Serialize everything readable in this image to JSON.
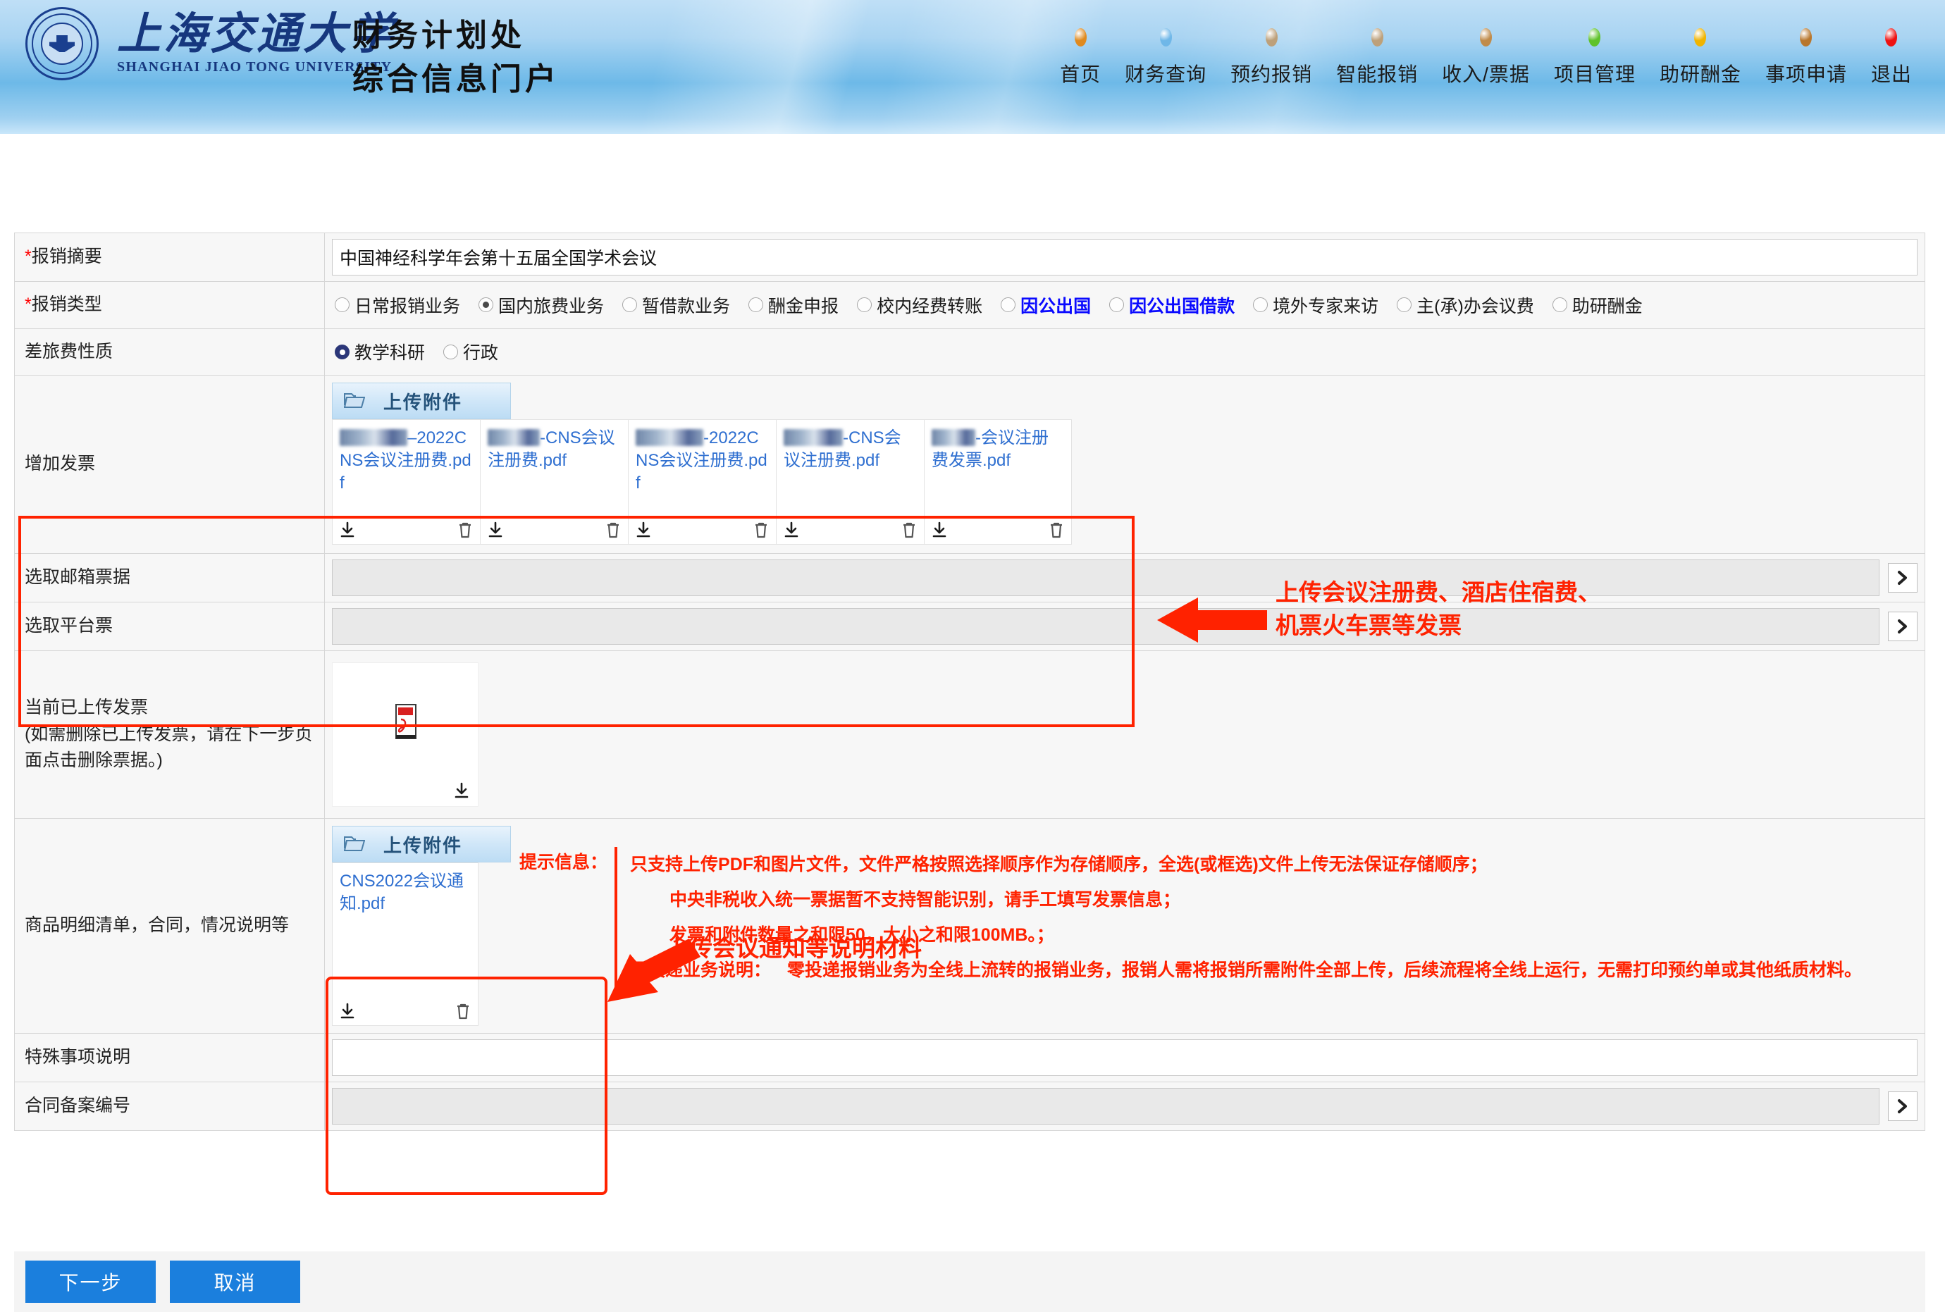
{
  "header": {
    "university_cn": "上海交通大学",
    "university_en": "SHANGHAI JIAO TONG UNIVERSITY",
    "dept_line1": "财务计划处",
    "dept_line2": "综合信息门户",
    "nav": [
      {
        "label": "首页",
        "dot": "#e08a1e"
      },
      {
        "label": "财务查询",
        "dot": "#6fb7e8"
      },
      {
        "label": "预约报销",
        "dot": "#bda07a"
      },
      {
        "label": "智能报销",
        "dot": "#bda07a"
      },
      {
        "label": "收入/票据",
        "dot": "#c08b4a"
      },
      {
        "label": "项目管理",
        "dot": "#5fc22a"
      },
      {
        "label": "助研酬金",
        "dot": "#f0b400"
      },
      {
        "label": "事项申请",
        "dot": "#b8762c"
      },
      {
        "label": "退出",
        "dot": "#ee1111"
      }
    ]
  },
  "form": {
    "summary": {
      "label": "报销摘要",
      "required": true,
      "value": "中国神经科学年会第十五届全国学术会议",
      "placeholder": ""
    },
    "reimb_type": {
      "label": "报销类型",
      "required": true,
      "options": [
        {
          "label": "日常报销业务",
          "selected": false,
          "blue": false
        },
        {
          "label": "国内旅费业务",
          "selected": true,
          "blue": false
        },
        {
          "label": "暂借款业务",
          "selected": false,
          "blue": false
        },
        {
          "label": "酬金申报",
          "selected": false,
          "blue": false
        },
        {
          "label": "校内经费转账",
          "selected": false,
          "blue": false
        },
        {
          "label": "因公出国",
          "selected": false,
          "blue": true
        },
        {
          "label": "因公出国借款",
          "selected": false,
          "blue": true
        },
        {
          "label": "境外专家来访",
          "selected": false,
          "blue": false
        },
        {
          "label": "主(承)办会议费",
          "selected": false,
          "blue": false
        },
        {
          "label": "助研酬金",
          "selected": false,
          "blue": false
        }
      ]
    },
    "travel_nature": {
      "label": "差旅费性质",
      "options": [
        {
          "label": "教学科研",
          "selected": true
        },
        {
          "label": "行政",
          "selected": false
        }
      ]
    },
    "add_invoice": {
      "label": "增加发票",
      "upload_button": "上传附件",
      "files": [
        {
          "redacted": true,
          "redact_width": 96,
          "name": "–2022CNS会议注册费.pdf"
        },
        {
          "redacted": true,
          "redact_width": 74,
          "name": "-CNS会议注册费.pdf"
        },
        {
          "redacted": true,
          "redact_width": 96,
          "name": "-2022CNS会议注册费.pdf"
        },
        {
          "redacted": true,
          "redact_width": 84,
          "name": "-CNS会议注册费.pdf"
        },
        {
          "redacted": true,
          "redact_width": 62,
          "name": "-会议注册费发票.pdf"
        }
      ]
    },
    "mail_invoice": {
      "label": "选取邮箱票据",
      "value": "",
      "placeholder": ""
    },
    "platform_invoice": {
      "label": "选取平台票",
      "value": "",
      "placeholder": ""
    },
    "uploaded_invoice": {
      "label_line1": "当前已上传发票",
      "label_line2": "(如需删除已上传发票，请在下一步页",
      "label_line3": "面点击删除票据。)",
      "thumb_type": "pdf-file-icon"
    },
    "attachments": {
      "label": "商品明细清单，合同，情况说明等",
      "upload_button": "上传附件",
      "files": [
        {
          "redacted": false,
          "name": "CNS2022会议通知.pdf"
        }
      ],
      "tips_label": "提示信息：",
      "tips": [
        "只支持上传PDF和图片文件，文件严格按照选择顺序作为存储顺序，全选(或框选)文件上传无法保证存储顺序；",
        "中央非税收入统一票据暂不支持智能识别，请手工填写发票信息；",
        "发票和附件数量之和限50，大小之和限100MB。；"
      ],
      "zero_delivery_label": "零投递业务说明：",
      "zero_delivery_text": "零投递报销业务为全线上流转的报销业务，报销人需将报销所需附件全部上传，后续流程将全线上运行，无需打印预约单或其他纸质材料。"
    },
    "special_note": {
      "label": "特殊事项说明",
      "value": "",
      "placeholder": ""
    },
    "contract_no": {
      "label": "合同备案编号",
      "value": "",
      "placeholder": ""
    }
  },
  "annotations": {
    "invoice_note_line1": "上传会议注册费、酒店住宿费、",
    "invoice_note_line2": "机票火车票等发票",
    "attachment_note": "上传会议通知等说明材料",
    "color": "#ff2200"
  },
  "footer": {
    "next_label": "下一步",
    "cancel_label": "取消",
    "button_color": "#1b7fdd"
  },
  "icons": {
    "folder": "folder-icon",
    "download": "download-icon",
    "trash": "trash-icon",
    "chevron": "chevron-right-icon",
    "pdf": "pdf-file-icon"
  }
}
